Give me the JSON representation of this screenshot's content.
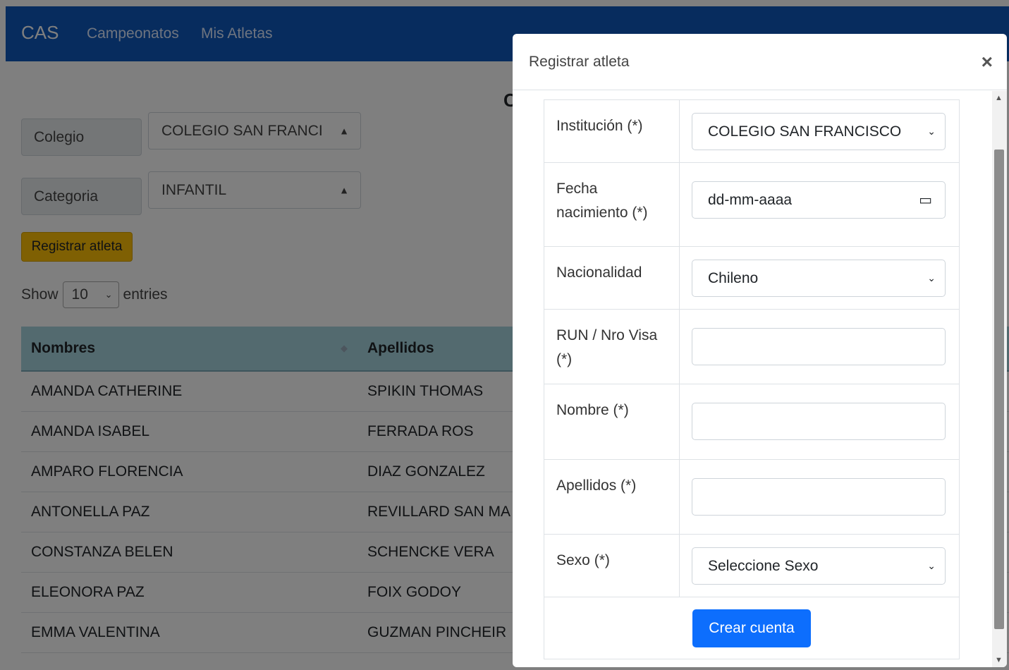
{
  "nav": {
    "brand": "CAS",
    "links": [
      "Campeonatos",
      "Mis Atletas"
    ]
  },
  "page": {
    "title_fragment": "C",
    "filters": [
      {
        "label": "Colegio",
        "value": "COLEGIO SAN FRANCI"
      },
      {
        "label": "Categoria",
        "value": "INFANTIL"
      }
    ],
    "register_button": "Registrar atleta",
    "length": {
      "show": "Show",
      "value": "10",
      "entries": "entries"
    }
  },
  "table": {
    "headers": [
      "Nombres",
      "Apellidos"
    ],
    "rows": [
      [
        "AMANDA CATHERINE",
        "SPIKIN THOMAS"
      ],
      [
        "AMANDA ISABEL",
        "FERRADA ROS"
      ],
      [
        "AMPARO FLORENCIA",
        "DIAZ GONZALEZ"
      ],
      [
        "ANTONELLA PAZ",
        "REVILLARD SAN MA"
      ],
      [
        "CONSTANZA BELEN",
        "SCHENCKE VERA"
      ],
      [
        "ELEONORA PAZ",
        "FOIX GODOY"
      ],
      [
        "EMMA VALENTINA",
        "GUZMAN PINCHEIR"
      ]
    ]
  },
  "modal": {
    "title": "Registrar atleta",
    "close": "×",
    "fields": [
      {
        "label": "Institución (*)",
        "value": "COLEGIO SAN FRANCISCO",
        "kind": "select"
      },
      {
        "label": "Fecha nacimiento (*)",
        "value": "dd-mm-aaaa",
        "kind": "date"
      },
      {
        "label": "Nacionalidad",
        "value": "Chileno",
        "kind": "select"
      },
      {
        "label": "RUN / Nro Visa (*)",
        "value": "",
        "kind": "text"
      },
      {
        "label": "Nombre (*)",
        "value": "",
        "kind": "text"
      },
      {
        "label": "Apellidos (*)",
        "value": "",
        "kind": "text"
      },
      {
        "label": "Sexo (*)",
        "value": "Seleccione Sexo",
        "kind": "select"
      }
    ],
    "submit": "Crear cuenta"
  },
  "icons": {
    "close": "close-icon",
    "select": "chevron-down-icon",
    "date": "calendar-icon",
    "sort": "sort-icon"
  }
}
